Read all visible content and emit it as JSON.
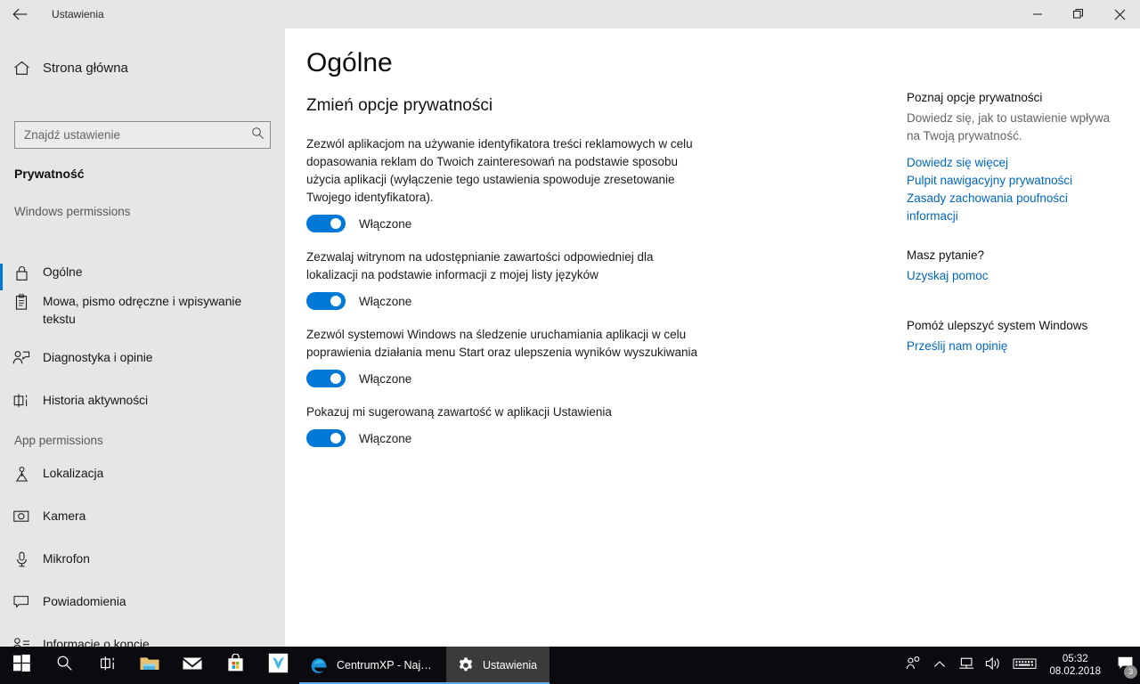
{
  "window": {
    "title": "Ustawienia",
    "back_icon": "back-arrow-icon",
    "minimize_label": "—",
    "restore_label": "❐",
    "close_label": "✕"
  },
  "sidebar": {
    "home_label": "Strona główna",
    "home_icon": "home-icon",
    "search": {
      "placeholder": "Znajdź ustawienie",
      "value": "",
      "icon": "search-icon"
    },
    "category_title": "Prywatność",
    "groups": [
      {
        "header": "Windows permissions",
        "items": [
          {
            "label": "Ogólne",
            "icon": "lock-icon",
            "selected": true
          },
          {
            "label": "Mowa, pismo odręczne i wpisywanie tekstu",
            "icon": "clipboard-icon",
            "selected": false
          },
          {
            "label": "Diagnostyka i opinie",
            "icon": "person-feedback-icon",
            "selected": false
          },
          {
            "label": "Historia aktywności",
            "icon": "activity-history-icon",
            "selected": false
          }
        ]
      },
      {
        "header": "App permissions",
        "items": [
          {
            "label": "Lokalizacja",
            "icon": "location-pin-icon",
            "selected": false
          },
          {
            "label": "Kamera",
            "icon": "camera-icon",
            "selected": false
          },
          {
            "label": "Mikrofon",
            "icon": "microphone-icon",
            "selected": false
          },
          {
            "label": "Powiadomienia",
            "icon": "notification-icon",
            "selected": false
          },
          {
            "label": "Informacje o koncie",
            "icon": "account-info-icon",
            "selected": false
          }
        ]
      }
    ]
  },
  "main": {
    "page_title": "Ogólne",
    "section_title": "Zmień opcje prywatności",
    "settings": [
      {
        "description": "Zezwól aplikacjom na używanie identyfikatora treści reklamowych w celu dopasowania reklam do Twoich zainteresowań na podstawie sposobu użycia aplikacji (wyłączenie tego ustawienia spowoduje zresetowanie Twojego identyfikatora).",
        "toggle_label": "Włączone",
        "toggle_on": true
      },
      {
        "description": "Zezwalaj witrynom na udostępnianie zawartości odpowiedniej dla lokalizacji na podstawie informacji z mojej listy języków",
        "toggle_label": "Włączone",
        "toggle_on": true
      },
      {
        "description": "Zezwól systemowi Windows na śledzenie uruchamiania aplikacji w celu poprawienia działania menu Start oraz ulepszenia wyników wyszukiwania",
        "toggle_label": "Włączone",
        "toggle_on": true
      },
      {
        "description": "Pokazuj mi sugerowaną zawartość w aplikacji Ustawienia",
        "toggle_label": "Włączone",
        "toggle_on": true
      }
    ]
  },
  "rail": {
    "groups": [
      {
        "head": "Poznaj opcje prywatności",
        "sub": "Dowiedz się, jak to ustawienie wpływa na Twoją prywatność.",
        "links": [
          "Dowiedz się więcej",
          "Pulpit nawigacyjny prywatności",
          "Zasady zachowania poufności informacji"
        ]
      },
      {
        "head": "Masz pytanie?",
        "sub": "",
        "links": [
          "Uzyskaj pomoc"
        ]
      },
      {
        "head": "Pomóż ulepszyć system Windows",
        "sub": "",
        "links": [
          "Prześlij nam opinię"
        ]
      }
    ]
  },
  "taskbar": {
    "icons": [
      {
        "name": "start-icon"
      },
      {
        "name": "search-icon"
      },
      {
        "name": "task-view-icon"
      },
      {
        "name": "file-explorer-icon"
      },
      {
        "name": "mail-icon"
      },
      {
        "name": "microsoft-store-icon"
      },
      {
        "name": "vivaldi-icon"
      }
    ],
    "apps": [
      {
        "label": "CentrumXP - Najle...",
        "icon": "edge-icon",
        "active": false
      },
      {
        "label": "Ustawienia",
        "icon": "gear-icon",
        "active": true
      }
    ],
    "tray": {
      "people_icon": "people-icon",
      "chevron_icon": "chevron-up-icon",
      "network_icon": "network-icon",
      "volume_icon": "volume-icon",
      "keyboard_icon": "keyboard-icon",
      "time": "05:32",
      "date": "08.02.2018",
      "notification_icon": "action-center-icon",
      "notification_count": "3"
    }
  },
  "colors": {
    "accent": "#0078d7",
    "link": "#0067c0",
    "sidebar_bg": "#e6e6e6",
    "taskbar_bg": "#0a0a0f"
  }
}
